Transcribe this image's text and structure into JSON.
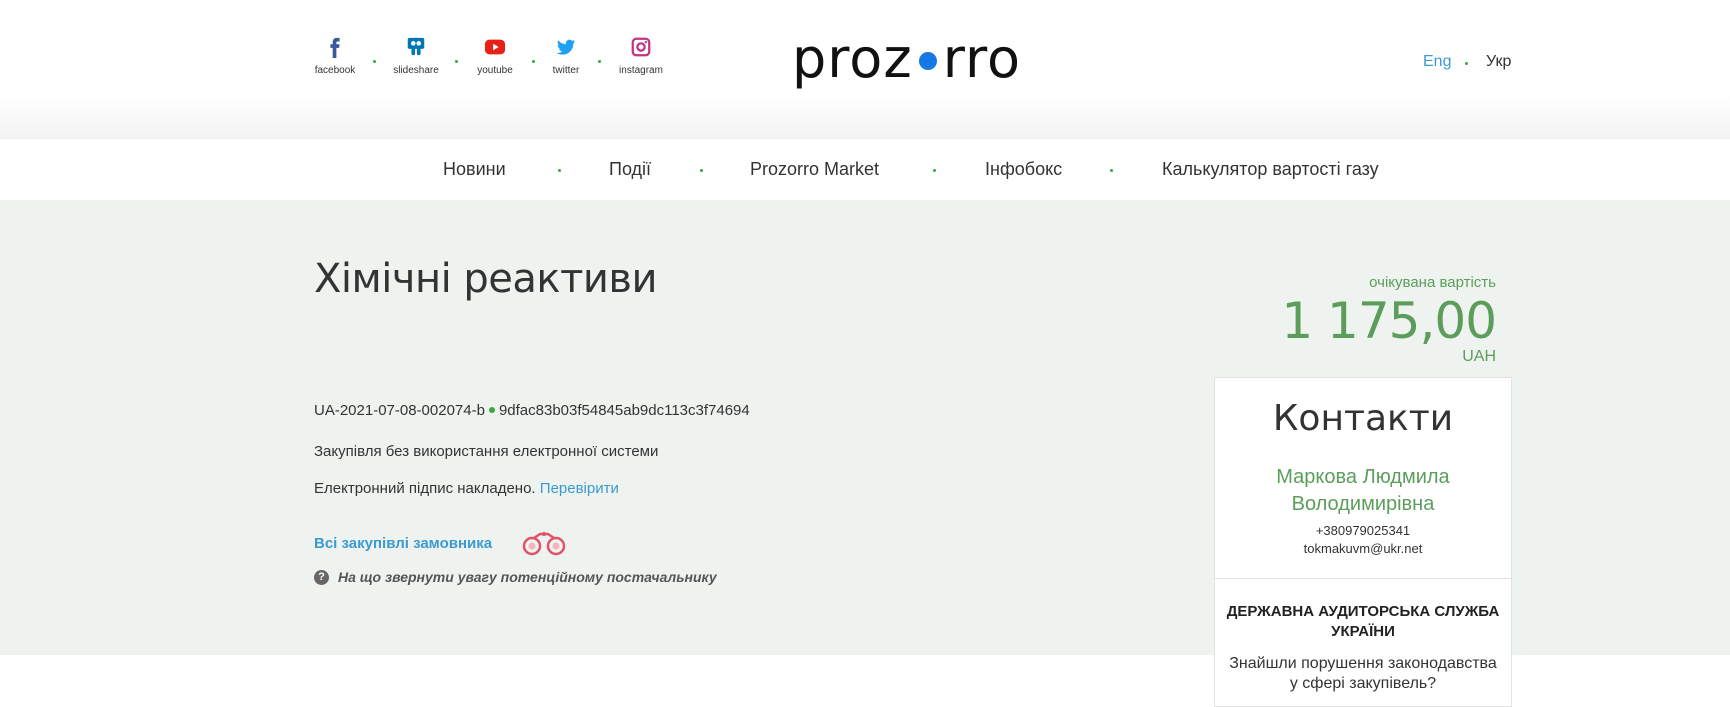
{
  "header": {
    "social": [
      {
        "label": "facebook",
        "icon": "facebook-icon"
      },
      {
        "label": "slideshare",
        "icon": "slideshare-icon"
      },
      {
        "label": "youtube",
        "icon": "youtube-icon"
      },
      {
        "label": "twitter",
        "icon": "twitter-icon"
      },
      {
        "label": "instagram",
        "icon": "instagram-icon"
      }
    ],
    "logo_text_left": "proz",
    "logo_text_right": "rro",
    "lang_eng": "Eng",
    "lang_ukr": "Укр"
  },
  "nav": {
    "items": [
      "Новини",
      "Події",
      "Prozorro Market",
      "Інфобокс",
      "Калькулятор вартості газу"
    ]
  },
  "tender": {
    "title": "Хімічні реактиви",
    "id": "UA-2021-07-08-002074-b",
    "hash": "9dfac83b03f54845ab9dc113c3f74694",
    "procedure": "Закупівля без використання електронної системи",
    "signature_text": "Електронний підпис накладено.",
    "signature_link": "Перевірити",
    "all_buys": "Всі закупівлі замовника",
    "attention": "На що звернути увагу потенційному постачальнику"
  },
  "expected": {
    "label": "очікувана вартість",
    "value": "1 175,00",
    "currency": "UAH"
  },
  "contacts": {
    "heading": "Контакти",
    "name_line1": "Маркова Людмила",
    "name_line2": "Володимирівна",
    "phone": "+380979025341",
    "email": "tokmakuvm@ukr.net",
    "das_title": "ДЕРЖАВНА АУДИТОРСЬКА СЛУЖБА УКРАЇНИ",
    "das_question": "Знайшли порушення законодавства у сфері закупівель?"
  },
  "colors": {
    "accent_green": "#5c9d5c",
    "link_blue": "#3c9ad3",
    "logo_dot": "#1479e6",
    "main_bg": "#eef3ef"
  }
}
